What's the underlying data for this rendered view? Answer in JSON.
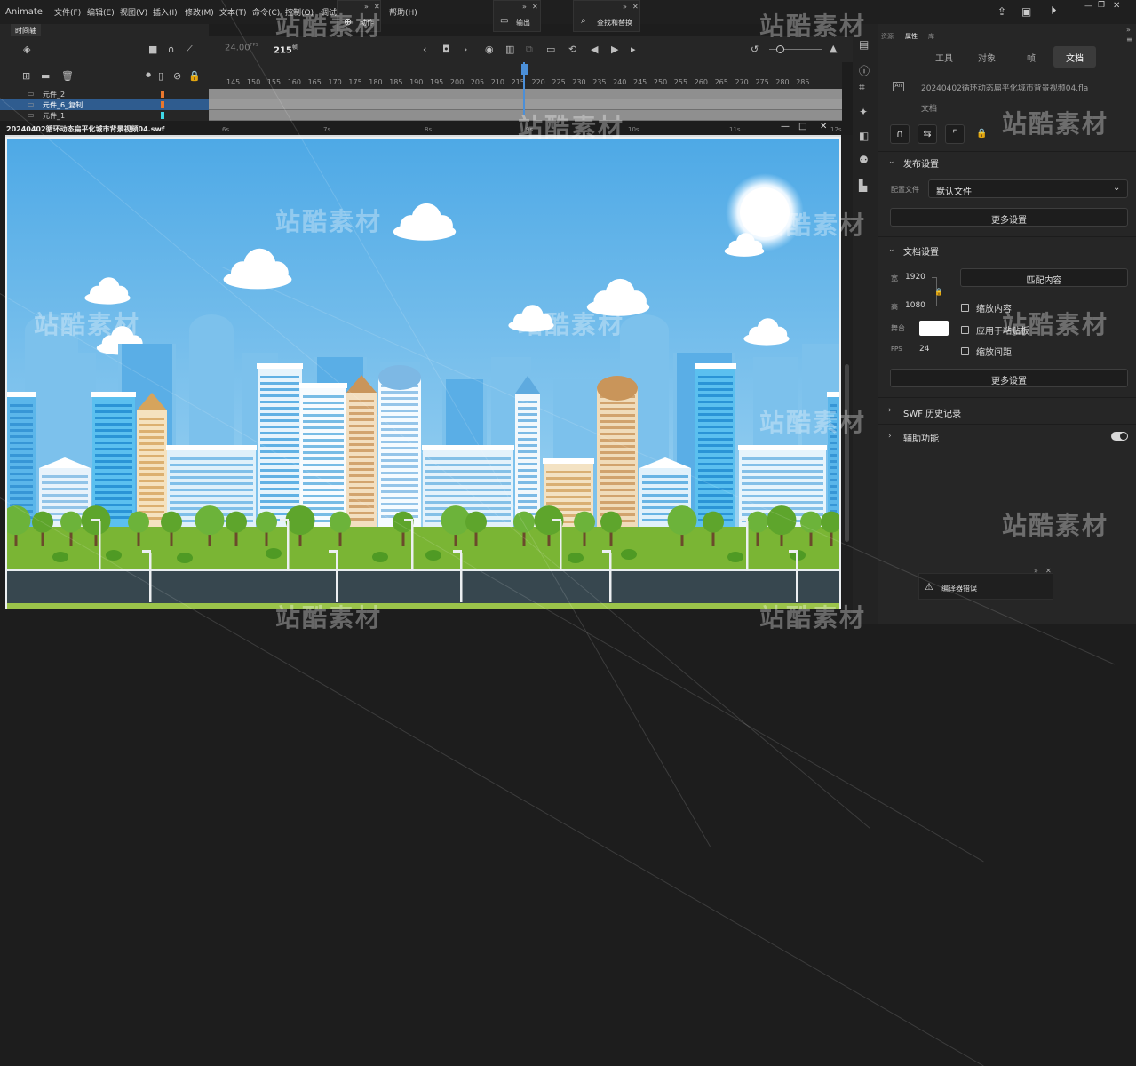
{
  "menubar": {
    "app_name": "Animate",
    "items": [
      "文件(F)",
      "编辑(E)",
      "视图(V)",
      "插入(I)",
      "修改(M)",
      "文本(T)",
      "命令(C)",
      "控制(O)",
      "调试",
      "帮助(H)"
    ],
    "panels": {
      "motion": "动作",
      "output": "输出",
      "find_replace": "查找和替换"
    }
  },
  "timeline": {
    "tab_label": "时间轴",
    "fps": "24.00",
    "fps_unit": "FPS",
    "current_frame": "215",
    "frame_unit": "帧",
    "frame_numbers": [
      "145",
      "150",
      "155",
      "160",
      "165",
      "170",
      "175",
      "180",
      "185",
      "190",
      "195",
      "200",
      "205",
      "210",
      "215",
      "220",
      "225",
      "230",
      "235",
      "240",
      "245",
      "250",
      "255",
      "260",
      "265",
      "270",
      "275",
      "280",
      "285"
    ],
    "second_marks": [
      "6s",
      "7s",
      "8s",
      "9s",
      "10s",
      "11s",
      "12s"
    ],
    "layers": [
      {
        "name": "元件_2",
        "color": "#e8772e",
        "selected": false
      },
      {
        "name": "元件_6_复制",
        "color": "#e8772e",
        "selected": true
      },
      {
        "name": "元件_1",
        "color": "#3fd7e6",
        "selected": false
      }
    ]
  },
  "document": {
    "title": "20240402循环动态扁平化城市背景视频04.swf",
    "win_controls": [
      "—",
      "□",
      "✕"
    ]
  },
  "properties": {
    "tabs": [
      "资源",
      "属性",
      "库"
    ],
    "segments": [
      "工具",
      "对象",
      "帧",
      "文档"
    ],
    "active_segment": "文档",
    "file_name": "20240402循环动态扁平化城市背景视频04.fla",
    "file_type": "文档",
    "publish_section": "发布设置",
    "profile_label": "配置文件",
    "profile_value": "默认文件",
    "more_settings": "更多设置",
    "doc_settings_section": "文档设置",
    "width_label": "宽",
    "width_value": "1920",
    "height_label": "高",
    "height_value": "1080",
    "stage_label": "舞台",
    "stage_color": "#ffffff",
    "fps_label": "FPS",
    "fps_value": "24",
    "match_contents": "匹配内容",
    "scale_content": "缩放内容",
    "apply_pasteboard": "应用于粘贴板",
    "scale_spacing": "缩放间距",
    "more_settings_2": "更多设置",
    "swf_history": "SWF 历史记录",
    "accessibility": "辅助功能"
  },
  "compiler": {
    "label": "编译器错误"
  },
  "watermark": {
    "text": "站酷素材"
  },
  "colors": {
    "accent": "#4b8fd8",
    "sky_top": "#4ea9e6",
    "sky_bottom": "#a9d9f3",
    "grass": "#7ab534",
    "road": "#37474f"
  }
}
